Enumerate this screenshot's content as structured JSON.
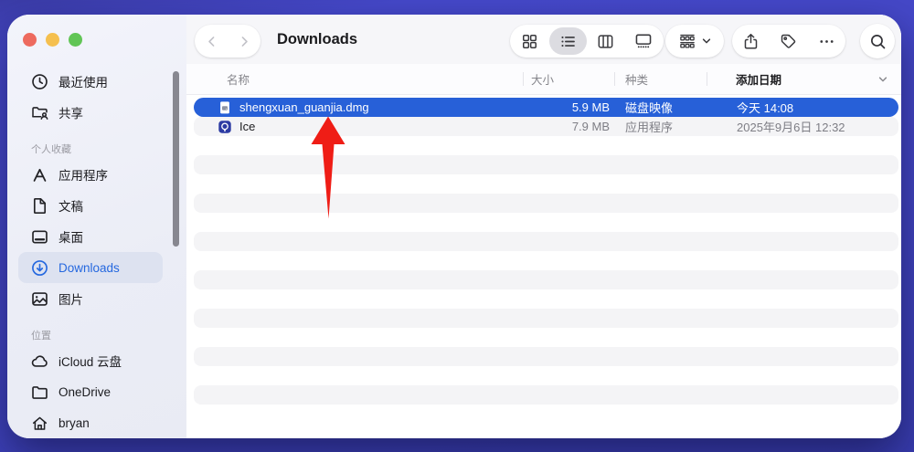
{
  "window": {
    "type": "finder",
    "controls": [
      {
        "id": "close",
        "color": "#ed6a5e"
      },
      {
        "id": "minimize",
        "color": "#f5bf4e"
      },
      {
        "id": "zoom",
        "color": "#61c555"
      }
    ]
  },
  "toolbar": {
    "back_icon": "chevron-left",
    "forward_icon": "chevron-right",
    "title": "Downloads",
    "view_buttons": [
      {
        "id": "icon-view",
        "icon": "grid-view",
        "selected": false
      },
      {
        "id": "list-view",
        "icon": "list-view",
        "selected": true
      },
      {
        "id": "column-view",
        "icon": "column-view",
        "selected": false
      },
      {
        "id": "gallery-view",
        "icon": "gallery-view",
        "selected": false
      }
    ],
    "group_icon": "group",
    "group_chevron_icon": "chevron-down-small",
    "share_icon": "share",
    "tag_icon": "tag",
    "more_icon": "ellipsis",
    "search_icon": "search"
  },
  "sidebar": {
    "sections": [
      {
        "header": null,
        "items": [
          {
            "id": "recents",
            "label": "最近使用",
            "icon": "clock",
            "selected": false
          },
          {
            "id": "shared",
            "label": "共享",
            "icon": "shared-folder",
            "selected": false
          }
        ]
      },
      {
        "header": "个人收藏",
        "items": [
          {
            "id": "applications",
            "label": "应用程序",
            "icon": "appstore",
            "selected": false
          },
          {
            "id": "documents",
            "label": "文稿",
            "icon": "document",
            "selected": false
          },
          {
            "id": "desktop",
            "label": "桌面",
            "icon": "desktop",
            "selected": false
          },
          {
            "id": "downloads",
            "label": "Downloads",
            "icon": "download",
            "selected": true
          },
          {
            "id": "pictures",
            "label": "图片",
            "icon": "photo",
            "selected": false
          }
        ]
      },
      {
        "header": "位置",
        "items": [
          {
            "id": "icloud-drive",
            "label": "iCloud 云盘",
            "icon": "cloud",
            "selected": false
          },
          {
            "id": "onedrive",
            "label": "OneDrive",
            "icon": "folder",
            "selected": false
          },
          {
            "id": "home-bryan",
            "label": "bryan",
            "icon": "home",
            "selected": false
          }
        ]
      }
    ]
  },
  "table": {
    "columns": [
      {
        "label": "名称"
      },
      {
        "label": "大小"
      },
      {
        "label": "种类"
      },
      {
        "label": "添加日期",
        "sorted": true
      }
    ],
    "sort_indicator_icon": "chevron-down-small",
    "rows": [
      {
        "icon": "dmg-file",
        "name": "shengxuan_guanjia.dmg",
        "size": "5.9 MB",
        "kind": "磁盘映像",
        "date_added": "今天 14:08",
        "selected": true
      },
      {
        "icon": "ice-app",
        "name": "Ice",
        "size": "7.9 MB",
        "kind": "应用程序",
        "date_added": "2025年9月6日 12:32",
        "selected": false
      }
    ],
    "empty_row_count": 15
  },
  "annotation": {
    "type": "arrow-up",
    "color": "#ef1d16",
    "points_to": "shengxuan_guanjia.dmg"
  },
  "colors": {
    "selection": "#2760d8",
    "accent": "#2568df",
    "stripe": "#f4f4f6",
    "desktop": "#4245c2",
    "arrow": "#ef1d16"
  }
}
